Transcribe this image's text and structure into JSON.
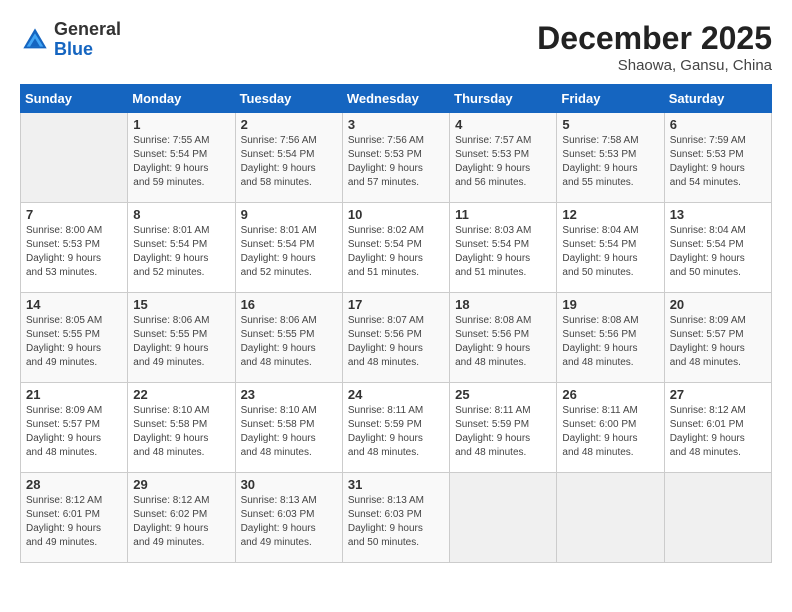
{
  "header": {
    "logo_line1": "General",
    "logo_line2": "Blue",
    "month": "December 2025",
    "location": "Shaowa, Gansu, China"
  },
  "days_of_week": [
    "Sunday",
    "Monday",
    "Tuesday",
    "Wednesday",
    "Thursday",
    "Friday",
    "Saturday"
  ],
  "weeks": [
    [
      {
        "day": "",
        "empty": true
      },
      {
        "day": "1",
        "sunrise": "7:55 AM",
        "sunset": "5:54 PM",
        "daylight": "9 hours and 59 minutes."
      },
      {
        "day": "2",
        "sunrise": "7:56 AM",
        "sunset": "5:54 PM",
        "daylight": "9 hours and 58 minutes."
      },
      {
        "day": "3",
        "sunrise": "7:56 AM",
        "sunset": "5:53 PM",
        "daylight": "9 hours and 57 minutes."
      },
      {
        "day": "4",
        "sunrise": "7:57 AM",
        "sunset": "5:53 PM",
        "daylight": "9 hours and 56 minutes."
      },
      {
        "day": "5",
        "sunrise": "7:58 AM",
        "sunset": "5:53 PM",
        "daylight": "9 hours and 55 minutes."
      },
      {
        "day": "6",
        "sunrise": "7:59 AM",
        "sunset": "5:53 PM",
        "daylight": "9 hours and 54 minutes."
      }
    ],
    [
      {
        "day": "7",
        "sunrise": "8:00 AM",
        "sunset": "5:53 PM",
        "daylight": "9 hours and 53 minutes."
      },
      {
        "day": "8",
        "sunrise": "8:01 AM",
        "sunset": "5:54 PM",
        "daylight": "9 hours and 52 minutes."
      },
      {
        "day": "9",
        "sunrise": "8:01 AM",
        "sunset": "5:54 PM",
        "daylight": "9 hours and 52 minutes."
      },
      {
        "day": "10",
        "sunrise": "8:02 AM",
        "sunset": "5:54 PM",
        "daylight": "9 hours and 51 minutes."
      },
      {
        "day": "11",
        "sunrise": "8:03 AM",
        "sunset": "5:54 PM",
        "daylight": "9 hours and 51 minutes."
      },
      {
        "day": "12",
        "sunrise": "8:04 AM",
        "sunset": "5:54 PM",
        "daylight": "9 hours and 50 minutes."
      },
      {
        "day": "13",
        "sunrise": "8:04 AM",
        "sunset": "5:54 PM",
        "daylight": "9 hours and 50 minutes."
      }
    ],
    [
      {
        "day": "14",
        "sunrise": "8:05 AM",
        "sunset": "5:55 PM",
        "daylight": "9 hours and 49 minutes."
      },
      {
        "day": "15",
        "sunrise": "8:06 AM",
        "sunset": "5:55 PM",
        "daylight": "9 hours and 49 minutes."
      },
      {
        "day": "16",
        "sunrise": "8:06 AM",
        "sunset": "5:55 PM",
        "daylight": "9 hours and 48 minutes."
      },
      {
        "day": "17",
        "sunrise": "8:07 AM",
        "sunset": "5:56 PM",
        "daylight": "9 hours and 48 minutes."
      },
      {
        "day": "18",
        "sunrise": "8:08 AM",
        "sunset": "5:56 PM",
        "daylight": "9 hours and 48 minutes."
      },
      {
        "day": "19",
        "sunrise": "8:08 AM",
        "sunset": "5:56 PM",
        "daylight": "9 hours and 48 minutes."
      },
      {
        "day": "20",
        "sunrise": "8:09 AM",
        "sunset": "5:57 PM",
        "daylight": "9 hours and 48 minutes."
      }
    ],
    [
      {
        "day": "21",
        "sunrise": "8:09 AM",
        "sunset": "5:57 PM",
        "daylight": "9 hours and 48 minutes."
      },
      {
        "day": "22",
        "sunrise": "8:10 AM",
        "sunset": "5:58 PM",
        "daylight": "9 hours and 48 minutes."
      },
      {
        "day": "23",
        "sunrise": "8:10 AM",
        "sunset": "5:58 PM",
        "daylight": "9 hours and 48 minutes."
      },
      {
        "day": "24",
        "sunrise": "8:11 AM",
        "sunset": "5:59 PM",
        "daylight": "9 hours and 48 minutes."
      },
      {
        "day": "25",
        "sunrise": "8:11 AM",
        "sunset": "5:59 PM",
        "daylight": "9 hours and 48 minutes."
      },
      {
        "day": "26",
        "sunrise": "8:11 AM",
        "sunset": "6:00 PM",
        "daylight": "9 hours and 48 minutes."
      },
      {
        "day": "27",
        "sunrise": "8:12 AM",
        "sunset": "6:01 PM",
        "daylight": "9 hours and 48 minutes."
      }
    ],
    [
      {
        "day": "28",
        "sunrise": "8:12 AM",
        "sunset": "6:01 PM",
        "daylight": "9 hours and 49 minutes."
      },
      {
        "day": "29",
        "sunrise": "8:12 AM",
        "sunset": "6:02 PM",
        "daylight": "9 hours and 49 minutes."
      },
      {
        "day": "30",
        "sunrise": "8:13 AM",
        "sunset": "6:03 PM",
        "daylight": "9 hours and 49 minutes."
      },
      {
        "day": "31",
        "sunrise": "8:13 AM",
        "sunset": "6:03 PM",
        "daylight": "9 hours and 50 minutes."
      },
      {
        "day": "",
        "empty": true
      },
      {
        "day": "",
        "empty": true
      },
      {
        "day": "",
        "empty": true
      }
    ]
  ]
}
